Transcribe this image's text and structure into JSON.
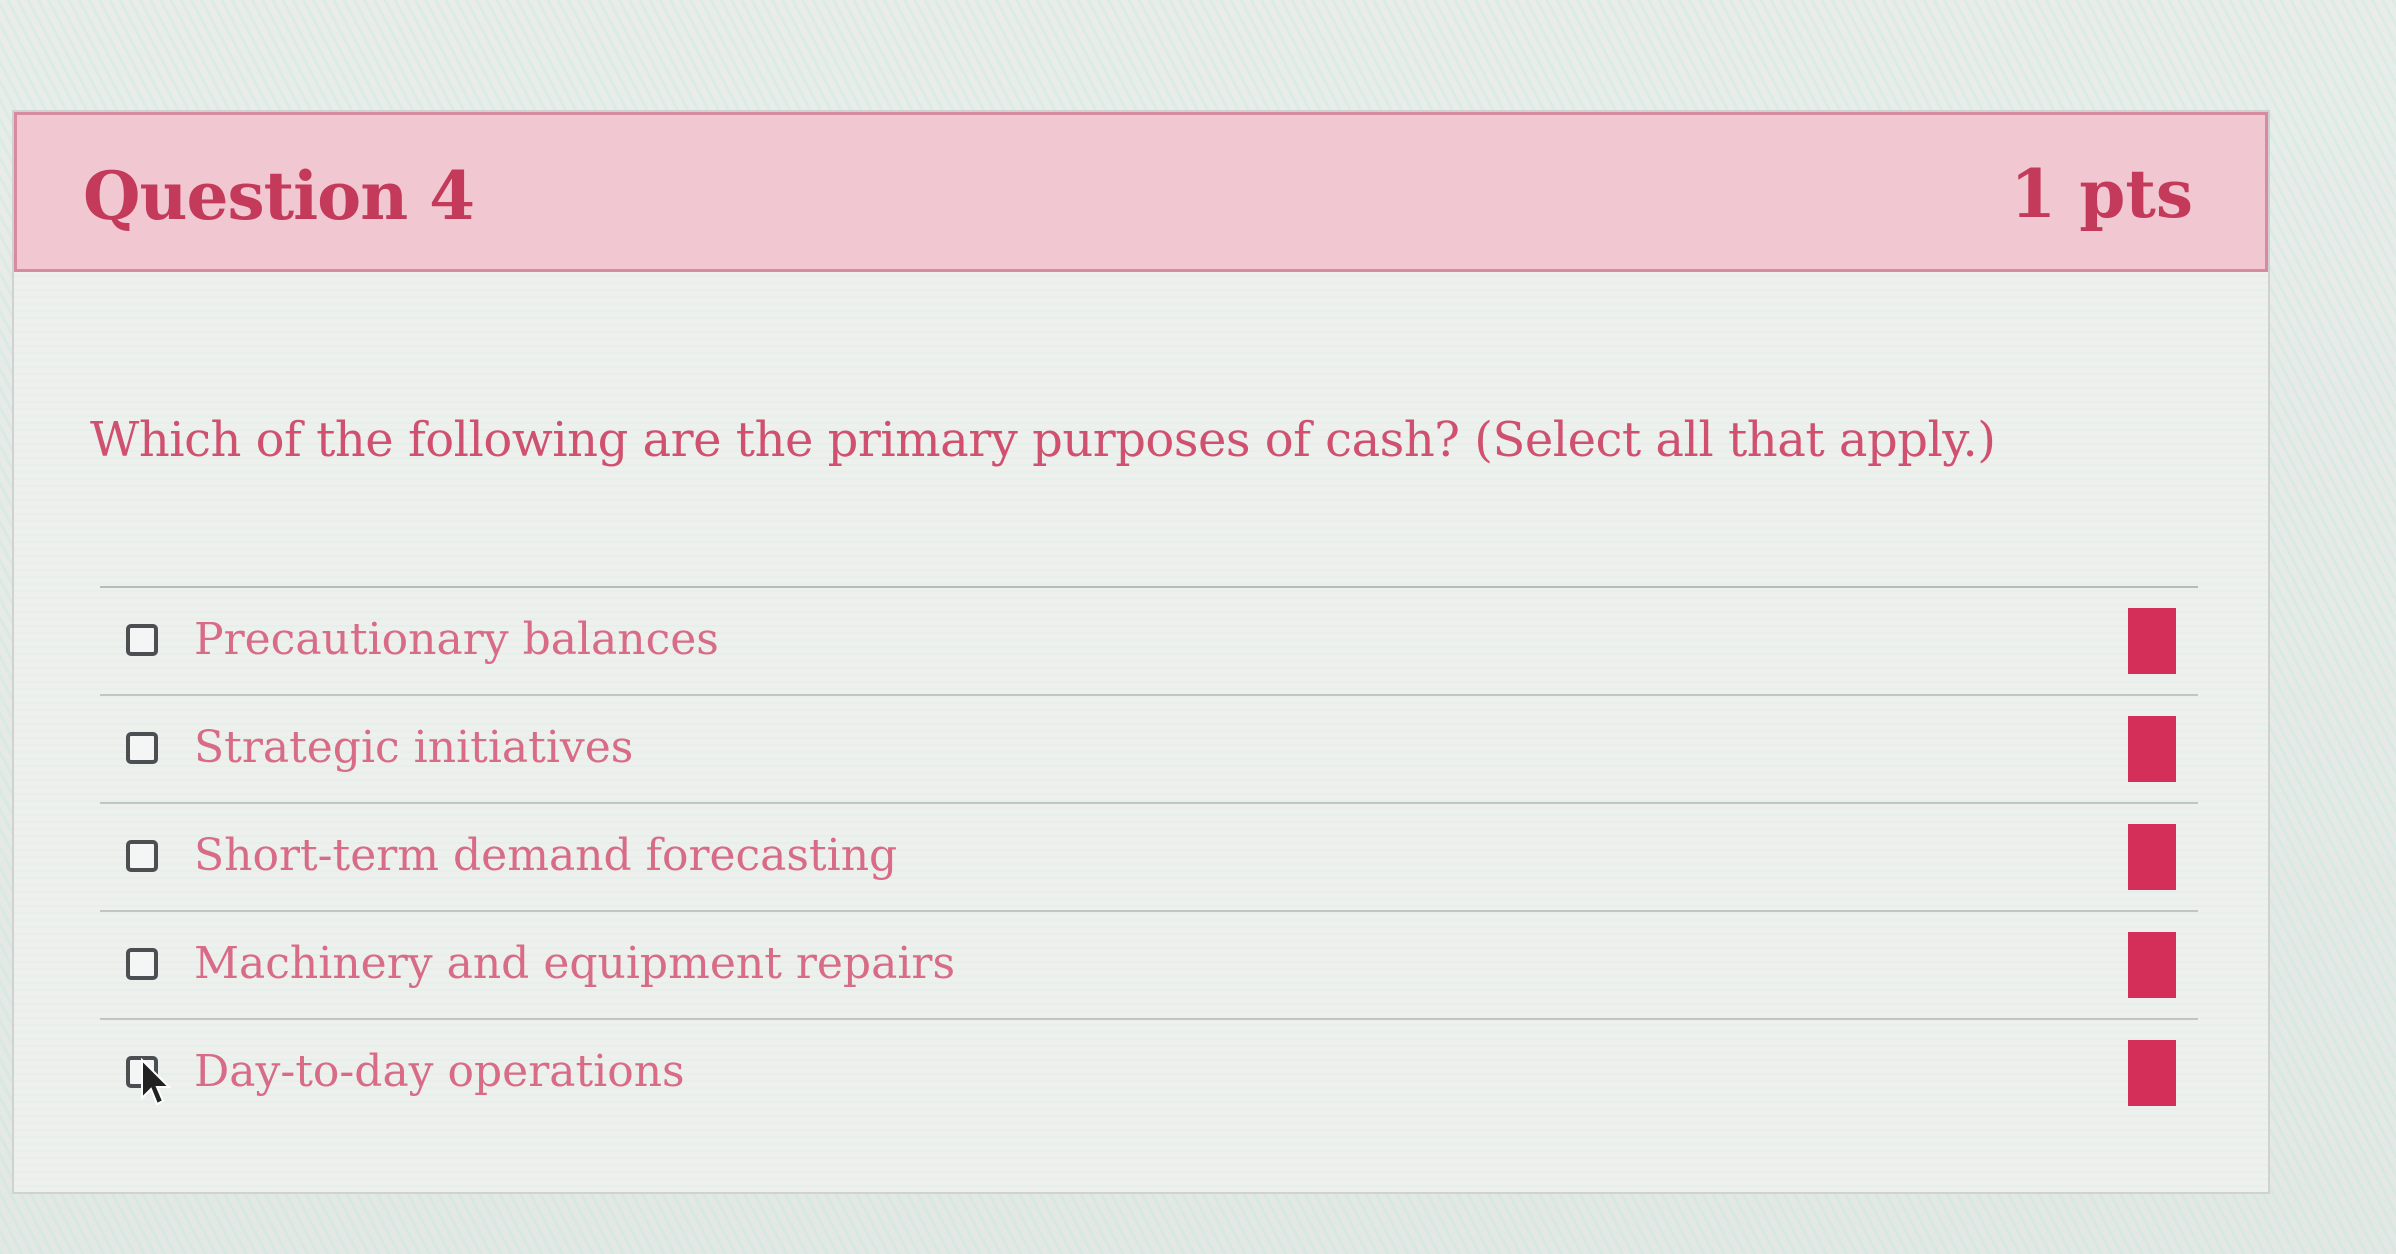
{
  "question": {
    "title": "Question 4",
    "points": "1 pts",
    "prompt": "Which of the following are the primary purposes of cash? (Select all that apply.)"
  },
  "answers": [
    {
      "label": "Precautionary balances",
      "checked": false
    },
    {
      "label": "Strategic initiatives",
      "checked": false
    },
    {
      "label": "Short-term demand forecasting",
      "checked": false
    },
    {
      "label": "Machinery and equipment repairs",
      "checked": false
    },
    {
      "label": "Day-to-day operations",
      "checked": false
    }
  ],
  "colors": {
    "header_bg": "#f1c8d1",
    "accent": "#c43a5b",
    "answer_text": "#d86b86",
    "flag": "#d32f58"
  },
  "icons": {
    "cursor": "hand-pointer-icon",
    "flag": "flag-marker-icon"
  }
}
